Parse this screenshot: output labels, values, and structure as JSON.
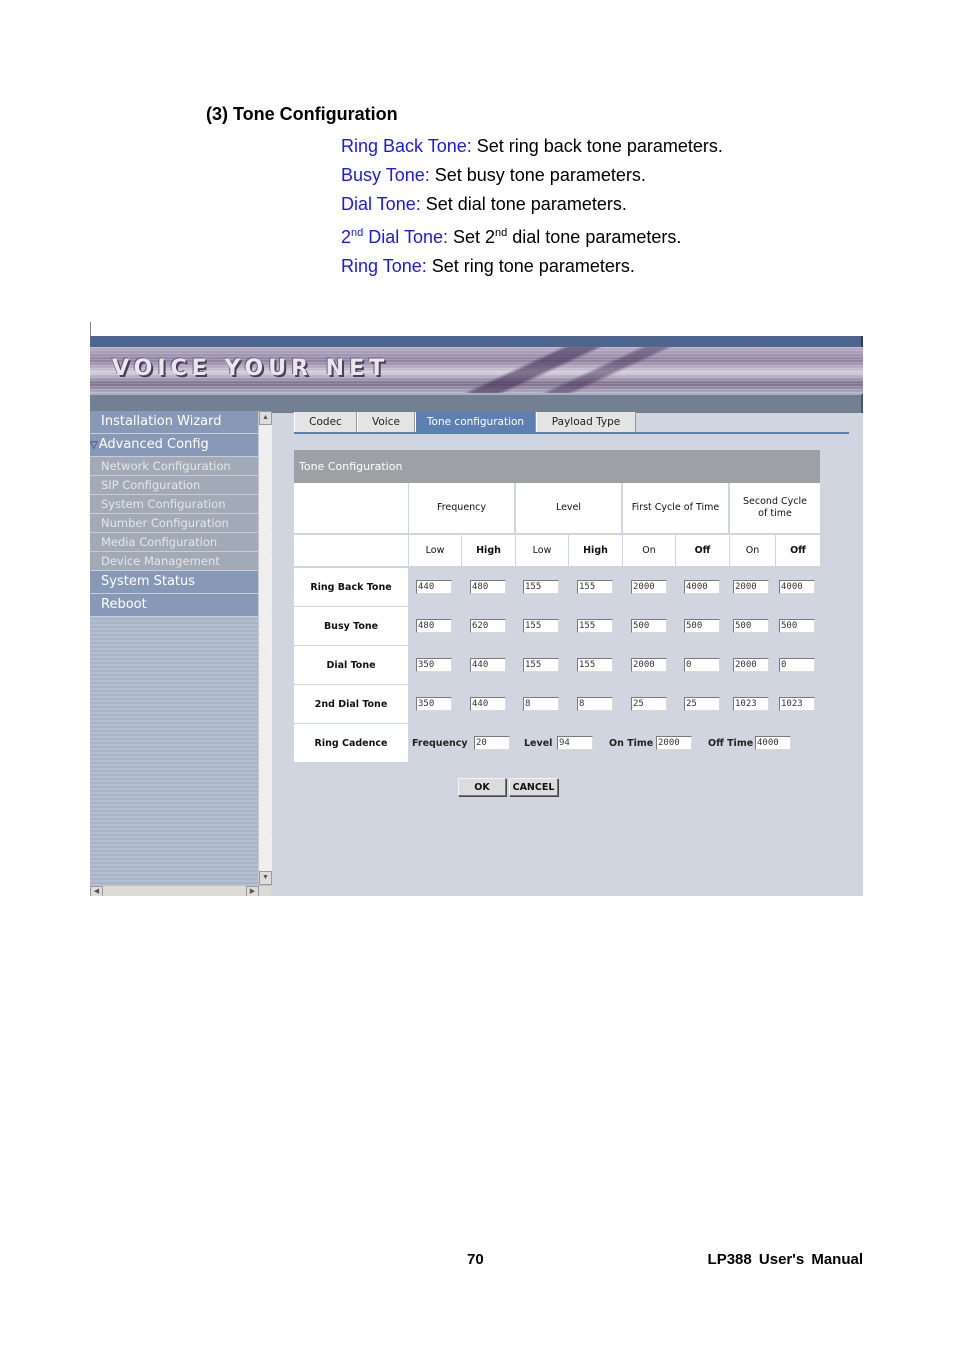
{
  "doc": {
    "heading": "(3) Tone Configuration",
    "items": [
      {
        "term": "Ring Back Tone:",
        "desc": " Set ring back tone parameters."
      },
      {
        "term": "Busy Tone:",
        "desc": " Set busy tone parameters."
      },
      {
        "term": "Dial Tone:",
        "desc": " Set dial tone parameters."
      },
      {
        "term_pre": "2",
        "term_sup": "nd",
        "term_post": " Dial Tone:",
        "desc_pre": " Set 2",
        "desc_sup": "nd",
        "desc_post": " dial tone parameters."
      },
      {
        "term": "Ring Tone:",
        "desc": " Set ring tone parameters."
      }
    ],
    "term_color": "#1a1aee"
  },
  "banner": {
    "text": "VOICE YOUR NET"
  },
  "sidebar": {
    "items": [
      {
        "label": "Installation Wizard"
      },
      {
        "label": "Advanced Config",
        "icon": "triangle-down-icon"
      },
      {
        "label": "Network Configuration"
      },
      {
        "label": "SIP Configuration"
      },
      {
        "label": "System Configuration"
      },
      {
        "label": "Number Configuration"
      },
      {
        "label": "Media Configuration"
      },
      {
        "label": "Device Management"
      },
      {
        "label": "System Status"
      },
      {
        "label": "Reboot"
      }
    ]
  },
  "tabs": [
    {
      "label": "Codec",
      "active": false
    },
    {
      "label": "Voice",
      "active": false
    },
    {
      "label": "Tone configuration",
      "active": true
    },
    {
      "label": "Payload Type",
      "active": false
    }
  ],
  "panel": {
    "title": "Tone Configuration",
    "group_headers": [
      "Frequency",
      "Level",
      "First Cycle of Time",
      "Second Cycle of time"
    ],
    "sub_headers": [
      "Low",
      "High",
      "Low",
      "High",
      "On",
      "Off",
      "On",
      "Off"
    ],
    "rows": [
      {
        "label": "Ring Back Tone",
        "values": [
          "440",
          "480",
          "155",
          "155",
          "2000",
          "4000",
          "2000",
          "4000"
        ]
      },
      {
        "label": "Busy Tone",
        "values": [
          "480",
          "620",
          "155",
          "155",
          "500",
          "500",
          "500",
          "500"
        ]
      },
      {
        "label": "Dial Tone",
        "values": [
          "350",
          "440",
          "155",
          "155",
          "2000",
          "0",
          "2000",
          "0"
        ]
      },
      {
        "label": "2nd Dial Tone",
        "values": [
          "350",
          "440",
          "8",
          "8",
          "25",
          "25",
          "1023",
          "1023"
        ]
      }
    ],
    "cadence": {
      "label": "Ring Cadence",
      "fields": [
        {
          "label": "Frequency",
          "value": "20"
        },
        {
          "label": "Level",
          "value": "94"
        },
        {
          "label": "On Time",
          "value": "2000"
        },
        {
          "label": "Off Time",
          "value": "4000"
        }
      ]
    },
    "ok_label": "OK",
    "cancel_label": "CANCEL"
  },
  "footer": {
    "page": "70",
    "title": "LP388 User's Manual"
  }
}
